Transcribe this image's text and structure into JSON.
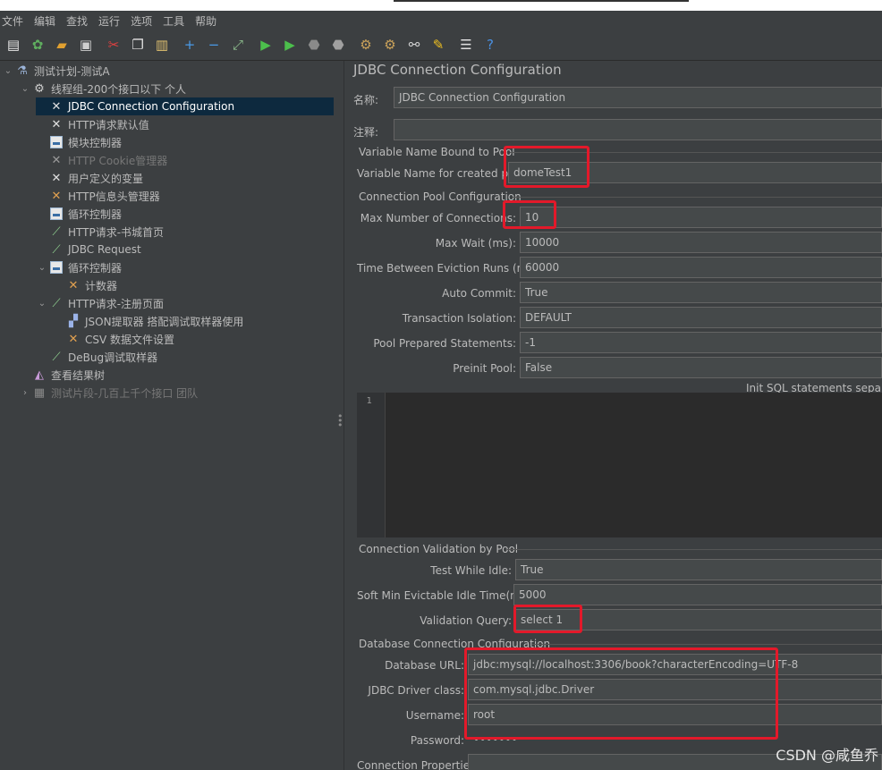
{
  "menu": [
    "文件",
    "编辑",
    "查找",
    "运行",
    "选项",
    "工具",
    "帮助"
  ],
  "toolbar": [
    {
      "name": "new-icon",
      "glyph": "▤",
      "color": "#e8e8e8"
    },
    {
      "name": "templates-icon",
      "glyph": "✿",
      "color": "#5fae5f"
    },
    {
      "name": "open-icon",
      "glyph": "▰",
      "color": "#e0a030"
    },
    {
      "name": "save-icon",
      "glyph": "▣",
      "color": "#cfcfcf"
    },
    {
      "name": "cut-icon",
      "glyph": "✂",
      "color": "#e04040"
    },
    {
      "name": "copy-icon",
      "glyph": "❐",
      "color": "#e0e0e0"
    },
    {
      "name": "paste-icon",
      "glyph": "▥",
      "color": "#e0c070"
    },
    {
      "name": "expand-icon",
      "glyph": "+",
      "color": "#4a9be8"
    },
    {
      "name": "collapse-icon",
      "glyph": "−",
      "color": "#4a9be8"
    },
    {
      "name": "toggle-icon",
      "glyph": "⤢",
      "color": "#8fc08f"
    },
    {
      "name": "start-icon",
      "glyph": "▶",
      "color": "#4cbf4c"
    },
    {
      "name": "start-no-pauses-icon",
      "glyph": "▶",
      "color": "#4cbf4c"
    },
    {
      "name": "stop-icon",
      "glyph": "⬣",
      "color": "#8a8a8a"
    },
    {
      "name": "shutdown-icon",
      "glyph": "⬣",
      "color": "#a0a0a0"
    },
    {
      "name": "clear-icon",
      "glyph": "⚙",
      "color": "#c9a15a"
    },
    {
      "name": "clear-all-icon",
      "glyph": "⚙",
      "color": "#c9a15a"
    },
    {
      "name": "search-icon",
      "glyph": "⚯",
      "color": "#d0d0d0"
    },
    {
      "name": "reset-search-icon",
      "glyph": "✎",
      "color": "#f0c020"
    },
    {
      "name": "function-helper-icon",
      "glyph": "☰",
      "color": "#e0e0e0"
    },
    {
      "name": "help-icon",
      "glyph": "?",
      "color": "#4a90e2"
    }
  ],
  "tree": [
    {
      "label": "测试计划-测试A",
      "icon": "flask-icon",
      "glyph": "⚗",
      "color": "#9bb3d8",
      "chevron": "⌄",
      "indent": 0
    },
    {
      "label": "线程组-200个接口以下 个人",
      "icon": "gear-icon",
      "glyph": "⚙",
      "color": "#d0d0d0",
      "chevron": "⌄",
      "indent": 1
    },
    {
      "label": "JDBC Connection Configuration",
      "icon": "wrench-icon",
      "glyph": "✕",
      "color": "#e0e0e0",
      "indent": 2,
      "selected": true
    },
    {
      "label": "HTTP请求默认值",
      "icon": "wrench-icon",
      "glyph": "✕",
      "color": "#e0e0e0",
      "indent": 2
    },
    {
      "label": "模块控制器",
      "icon": "controller-icon",
      "glyph": "box",
      "indent": 2
    },
    {
      "label": "HTTP Cookie管理器",
      "icon": "wrench-icon",
      "glyph": "✕",
      "color": "#9a9a9a",
      "indent": 2,
      "dim": true
    },
    {
      "label": "用户定义的变量",
      "icon": "wrench-icon",
      "glyph": "✕",
      "color": "#e0e0e0",
      "indent": 2
    },
    {
      "label": "HTTP信息头管理器",
      "icon": "wrench-icon",
      "glyph": "✕",
      "color": "#e0a050",
      "indent": 2
    },
    {
      "label": "循环控制器",
      "icon": "controller-icon",
      "glyph": "box",
      "indent": 2
    },
    {
      "label": "HTTP请求-书城首页",
      "icon": "pipette-icon",
      "glyph": "⟋",
      "color": "#8fd08f",
      "indent": 2
    },
    {
      "label": "JDBC Request",
      "icon": "pipette-icon",
      "glyph": "⟋",
      "color": "#8fd08f",
      "indent": 2
    },
    {
      "label": "循环控制器",
      "icon": "controller-icon",
      "glyph": "box",
      "chevron": "⌄",
      "indent": 2
    },
    {
      "label": "计数器",
      "icon": "wrench-icon",
      "glyph": "✕",
      "color": "#e0a050",
      "indent": 3
    },
    {
      "label": "HTTP请求-注册页面",
      "icon": "pipette-icon",
      "glyph": "⟋",
      "color": "#8fd08f",
      "chevron": "⌄",
      "indent": 2
    },
    {
      "label": "JSON提取器 搭配调试取样器使用",
      "icon": "extractor-icon",
      "glyph": "▞",
      "color": "#9bb3e8",
      "indent": 3
    },
    {
      "label": "CSV 数据文件设置",
      "icon": "wrench-icon",
      "glyph": "✕",
      "color": "#e0a050",
      "indent": 3
    },
    {
      "label": "DeBug调试取样器",
      "icon": "pipette-icon",
      "glyph": "⟋",
      "color": "#8fd08f",
      "indent": 2
    },
    {
      "label": "查看结果树",
      "icon": "listener-icon",
      "glyph": "◭",
      "color": "#c89ad8",
      "indent": 1
    },
    {
      "label": "测试片段-几百上千个接口 团队",
      "icon": "fragment-icon",
      "glyph": "▦",
      "color": "#8a8a8a",
      "chevron": "›",
      "indent": 1,
      "dim": true
    }
  ],
  "panel": {
    "title": "JDBC Connection Configuration",
    "name_label": "名称:",
    "name_value": "JDBC Connection Configuration",
    "comment_label": "注释:",
    "comment_value": "",
    "var_group": "Variable Name Bound to Pool",
    "var_label": "Variable Name for created pool:",
    "var_value": "domeTest1",
    "pool_group": "Connection Pool Configuration",
    "pool_fields": [
      {
        "label": "Max Number of Connections:",
        "value": "10"
      },
      {
        "label": "Max Wait (ms):",
        "value": "10000"
      },
      {
        "label": "Time Between Eviction Runs (ms):",
        "value": "60000"
      },
      {
        "label": "Auto Commit:",
        "value": "True"
      },
      {
        "label": "Transaction Isolation:",
        "value": "DEFAULT"
      },
      {
        "label": "Pool Prepared Statements:",
        "value": "-1"
      },
      {
        "label": "Preinit Pool:",
        "value": "False"
      }
    ],
    "init_sql_label": "Init SQL statements separated",
    "editor_line": "1",
    "validation_group": "Connection Validation by Pool",
    "validation_fields": [
      {
        "label": "Test While Idle:",
        "value": "True"
      },
      {
        "label": "Soft Min Evictable Idle Time(ms):",
        "value": "5000"
      },
      {
        "label": "Validation Query:",
        "value": "select 1"
      }
    ],
    "db_group": "Database Connection Configuration",
    "db_fields": [
      {
        "label": "Database URL:",
        "value": "jdbc:mysql://localhost:3306/book?characterEncoding=UTF-8"
      },
      {
        "label": "JDBC Driver class:",
        "value": "com.mysql.jdbc.Driver"
      },
      {
        "label": "Username:",
        "value": "root"
      },
      {
        "label": "Password:",
        "value": "•••••••"
      },
      {
        "label": "Connection Properties:",
        "value": ""
      }
    ]
  },
  "watermark": "CSDN @咸鱼乔"
}
